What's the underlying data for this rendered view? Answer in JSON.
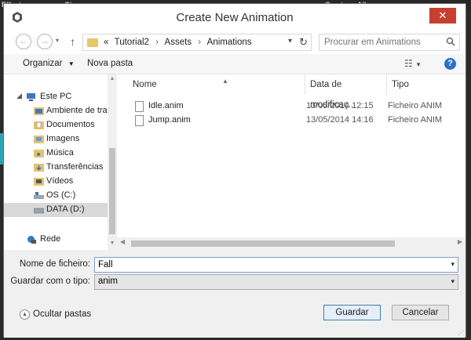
{
  "background": {
    "labels": [
      "Effects",
      "Gizmos",
      "Create",
      "All"
    ]
  },
  "dialog": {
    "title": "Create New Animation",
    "close_glyph": "✕"
  },
  "address": {
    "crumbs": [
      "«",
      "Tutorial2",
      "Assets",
      "Animations"
    ],
    "search_placeholder": "Procurar em Animations"
  },
  "toolbar": {
    "organize": "Organizar",
    "new_folder": "Nova pasta",
    "help": "?"
  },
  "nav": {
    "items": [
      {
        "label": "Este PC",
        "icon": "computer-icon"
      },
      {
        "label": "Ambiente de trab",
        "icon": "desktop-icon"
      },
      {
        "label": "Documentos",
        "icon": "documents-icon"
      },
      {
        "label": "Imagens",
        "icon": "pictures-icon"
      },
      {
        "label": "Música",
        "icon": "music-icon"
      },
      {
        "label": "Transferências",
        "icon": "downloads-icon"
      },
      {
        "label": "Vídeos",
        "icon": "videos-icon"
      },
      {
        "label": "OS (C:)",
        "icon": "drive-icon"
      },
      {
        "label": "DATA (D:)",
        "icon": "drive-icon"
      },
      {
        "label": "Rede",
        "icon": "network-icon"
      }
    ]
  },
  "files": {
    "columns": [
      "Nome",
      "Data de modificaç...",
      "Tipo"
    ],
    "rows": [
      {
        "name": "Idle.anim",
        "date": "13/05/2014 12:15",
        "type": "Ficheiro ANIM"
      },
      {
        "name": "Jump.anim",
        "date": "13/05/2014 14:16",
        "type": "Ficheiro ANIM"
      }
    ]
  },
  "form": {
    "filename_label": "Nome de ficheiro:",
    "filename_value": "Fall",
    "type_label": "Guardar com o tipo:",
    "type_value": "anim",
    "hide_folders": "Ocultar pastas",
    "save": "Guardar",
    "cancel": "Cancelar"
  }
}
